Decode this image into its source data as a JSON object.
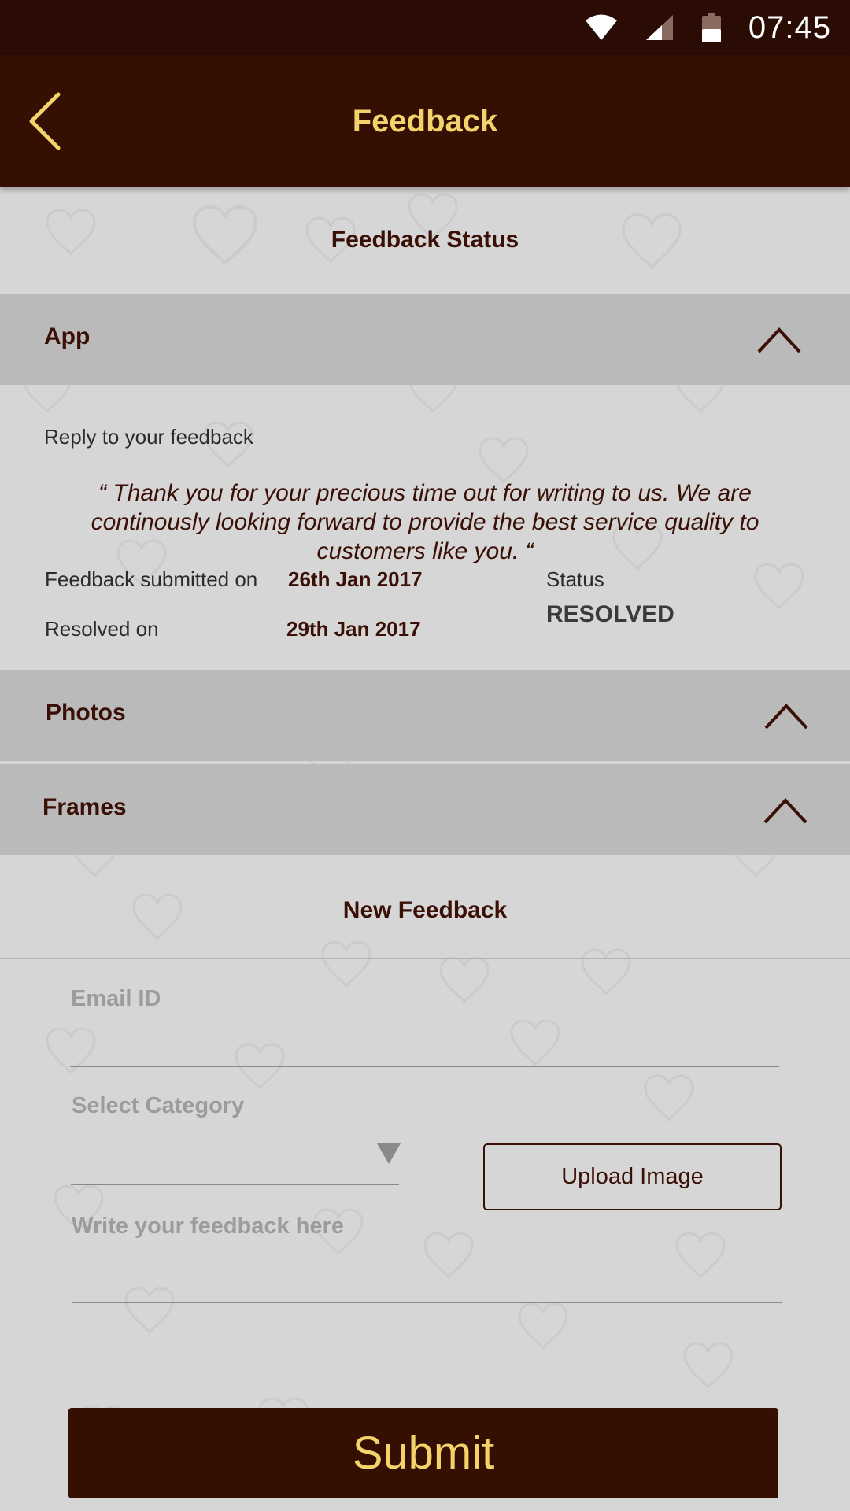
{
  "status_bar": {
    "time": "07:45",
    "icons": [
      "wifi-icon",
      "cell-signal-icon",
      "battery-icon"
    ]
  },
  "app_bar": {
    "title": "Feedback",
    "back_icon": "chevron-left-icon"
  },
  "feedback_status": {
    "title": "Feedback Status",
    "sections": [
      {
        "label": "App",
        "expanded_icon": "chevron-up-icon"
      },
      {
        "label": "Photos",
        "expanded_icon": "chevron-up-icon"
      },
      {
        "label": "Frames",
        "expanded_icon": "chevron-up-icon"
      }
    ],
    "reply_label": "Reply to your feedback",
    "reply_text": "“ Thank you for your precious time out for writing to us. We are continously looking forward to provide the best service quality to customers like you. “",
    "submitted_label": "Feedback submitted on",
    "submitted_date": "26th Jan 2017",
    "resolved_label": "Resolved on",
    "resolved_date": "29th Jan 2017",
    "status_label": "Status",
    "status_value": "RESOLVED"
  },
  "new_feedback": {
    "title": "New Feedback",
    "email_placeholder": "Email ID",
    "category_placeholder": "Select Category",
    "upload_label": "Upload Image",
    "feedback_placeholder": "Write your feedback here",
    "submit_label": "Submit"
  },
  "colors": {
    "primary_dark": "#360f03",
    "status_bar": "#2a0c04",
    "accent_gold": "#f5d36b",
    "accordion_bg": "#bababa",
    "page_bg": "#d6d6d6"
  }
}
